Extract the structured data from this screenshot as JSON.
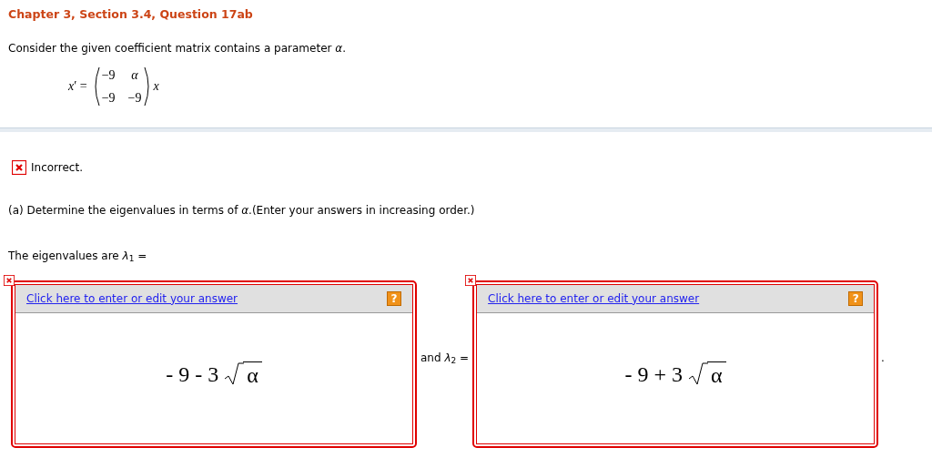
{
  "title": "Chapter 3, Section 3.4, Question 17ab",
  "intro": "Consider the given coefficient matrix contains a parameter *α*.",
  "equation": {
    "lhs": "*x*′ =",
    "rows": [
      [
        "−9",
        "*α*"
      ],
      [
        "−9",
        "−9"
      ]
    ],
    "rhs": "*x*"
  },
  "feedback": {
    "correct": false,
    "text": "Incorrect."
  },
  "prompt": "(a) Determine the eigenvalues in terms of *α*.(Enter your answers in increasing order.)",
  "lead": "The eigenvalues are *λ*$_{1}$ =",
  "answers": [
    {
      "link": "Click here to enter or edit your answer",
      "help": "?",
      "correct": false,
      "expression": "- 9 - 3",
      "radicand": "α"
    },
    {
      "link": "Click here to enter or edit your answer",
      "help": "?",
      "correct": false,
      "expression": "- 9 + 3",
      "radicand": "α"
    }
  ],
  "between": "and *λ*$_{2}$ =",
  "end": "."
}
